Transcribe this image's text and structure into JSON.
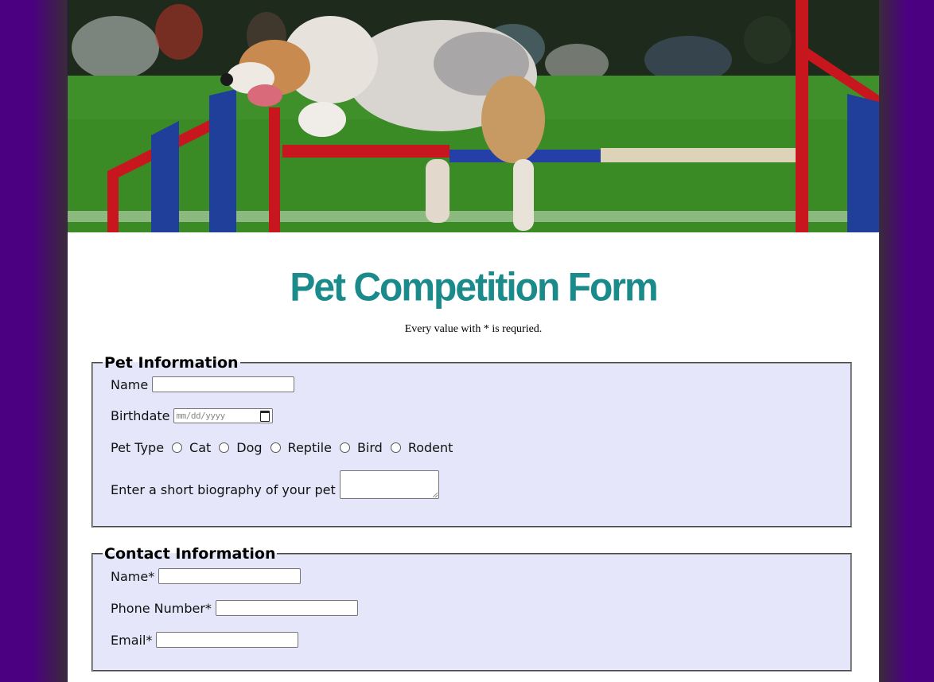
{
  "page": {
    "title": "Pet Competition Form",
    "note": "Every value with * is requried."
  },
  "hero": {
    "image": "agility-dog-jumping-hurdle"
  },
  "pet_section": {
    "legend": "Pet Information",
    "name_label": "Name",
    "name_value": "",
    "birthdate_label": "Birthdate",
    "birthdate_placeholder": "mm/dd/yyyy",
    "pet_type_label": "Pet Type",
    "pet_types": [
      "Cat",
      "Dog",
      "Reptile",
      "Bird",
      "Rodent"
    ],
    "bio_label": "Enter a short biography of your pet",
    "bio_value": ""
  },
  "contact_section": {
    "legend": "Contact Information",
    "name_label": "Name*",
    "phone_label": "Phone Number*",
    "email_label": "Email*"
  },
  "colors": {
    "background": "#4b0082",
    "title": "#1a8a8a",
    "fieldset_bg": "#e6e6fa"
  }
}
